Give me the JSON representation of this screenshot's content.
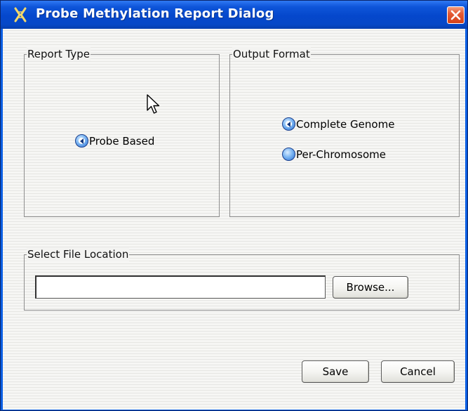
{
  "window": {
    "title": "Probe Methylation Report Dialog",
    "icons": {
      "app": "app-logo-icon",
      "close": "close-icon",
      "pointer": "mouse-pointer-icon"
    },
    "colors": {
      "titlebar": "#0547cc",
      "close_button": "#d54117"
    }
  },
  "report_type": {
    "legend": "Report Type",
    "options": [
      {
        "label": "Probe Based",
        "selected": true
      }
    ]
  },
  "output_format": {
    "legend": "Output Format",
    "options": [
      {
        "label": "Complete Genome",
        "selected": true
      },
      {
        "label": "Per-Chromosome",
        "selected": false
      }
    ]
  },
  "file_location": {
    "legend": "Select File Location",
    "path_value": "",
    "browse_label": "Browse..."
  },
  "footer": {
    "save_label": "Save",
    "cancel_label": "Cancel"
  }
}
